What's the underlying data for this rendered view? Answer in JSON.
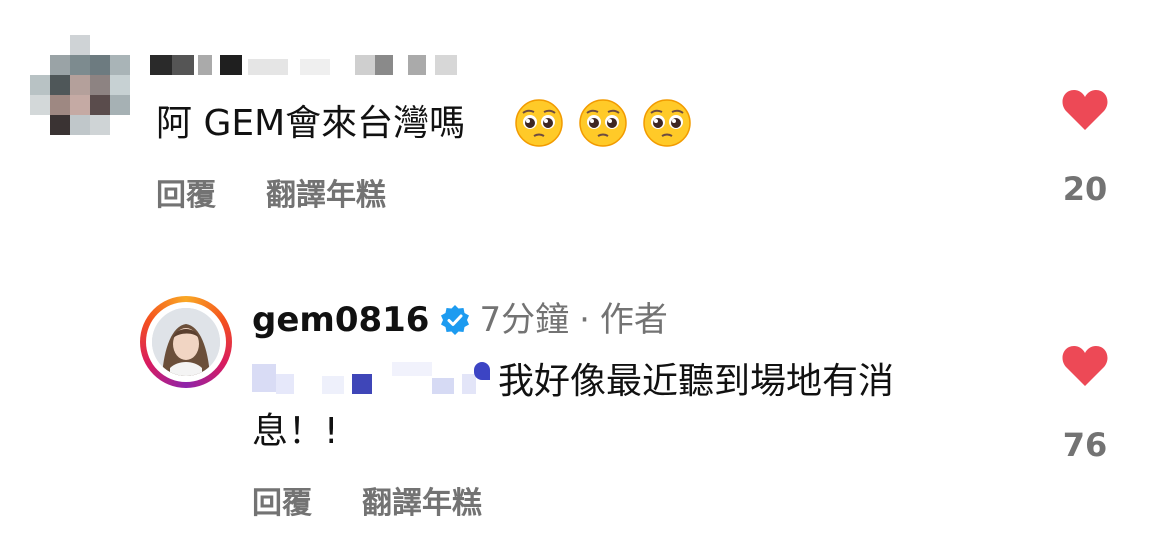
{
  "comments": [
    {
      "username": "",
      "text": "阿 GEM會來台灣嗎",
      "emojis": [
        "pleading-face-emoji",
        "pleading-face-emoji",
        "pleading-face-emoji"
      ],
      "actions": {
        "reply": "回覆",
        "translate": "翻譯年糕"
      },
      "likes": "20"
    },
    {
      "username": "gem0816",
      "verified": true,
      "time": "7分鐘",
      "separator": "·",
      "badge": "作者",
      "text_line1": "我好像最近聽到場地有消",
      "text_line2": "息！!",
      "actions": {
        "reply": "回覆",
        "translate": "翻譯年糕"
      },
      "likes": "76"
    }
  ],
  "colors": {
    "like": "#ed4956",
    "secondary_text": "#737373",
    "verified": "#1d9bf0"
  }
}
